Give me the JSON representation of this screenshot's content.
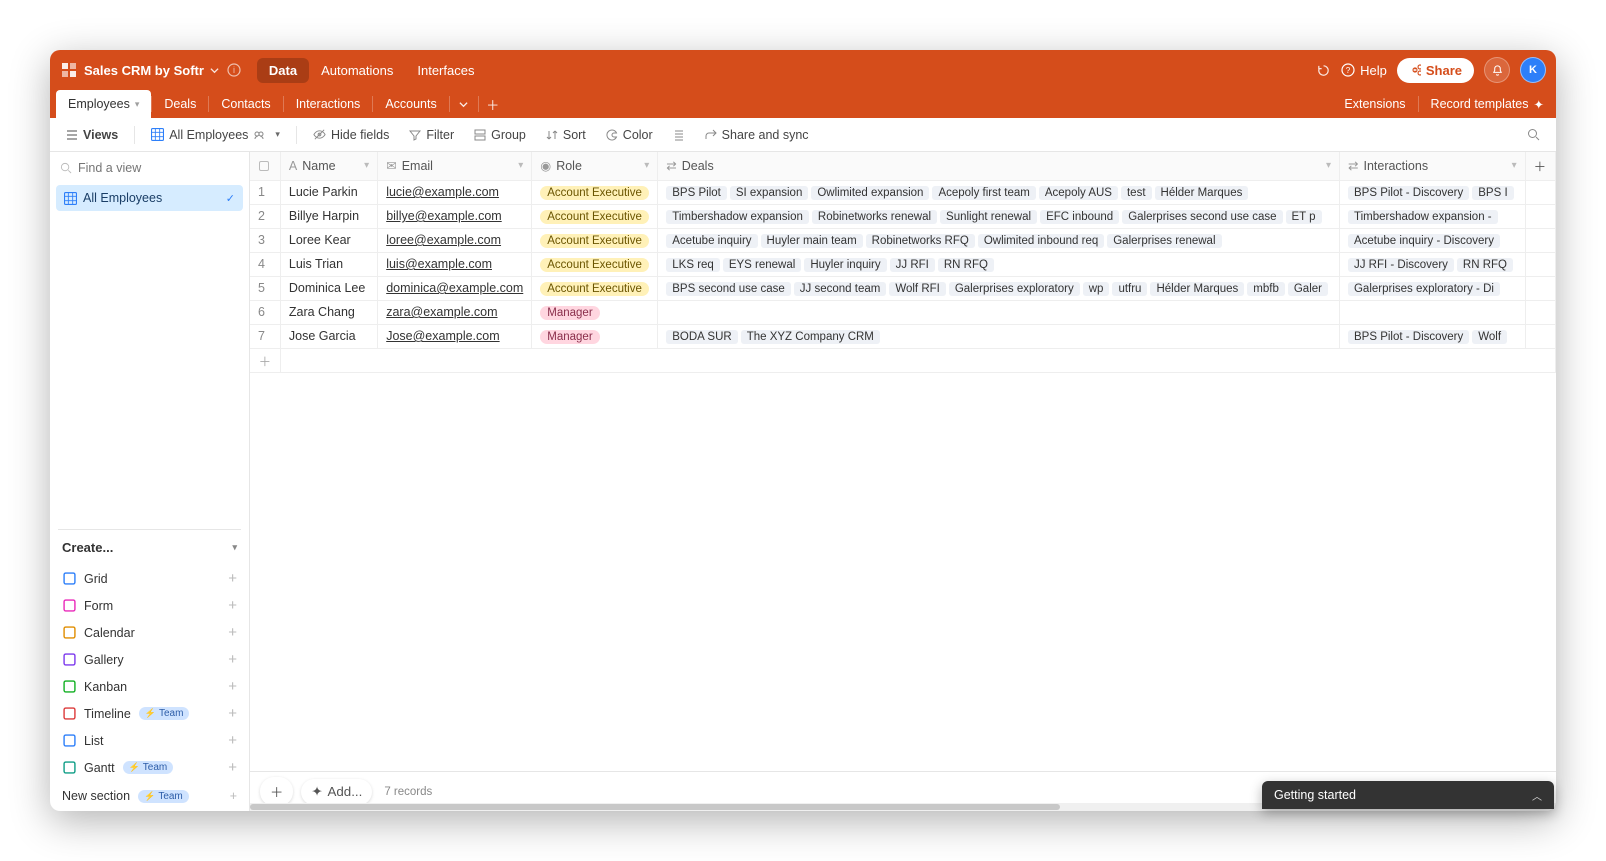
{
  "header": {
    "title": "Sales CRM by Softr",
    "nav": {
      "data": "Data",
      "automations": "Automations",
      "interfaces": "Interfaces"
    },
    "help": "Help",
    "share": "Share",
    "avatar_initial": "K"
  },
  "tabs": {
    "items": [
      {
        "label": "Employees",
        "active": true
      },
      {
        "label": "Deals"
      },
      {
        "label": "Contacts"
      },
      {
        "label": "Interactions"
      },
      {
        "label": "Accounts"
      }
    ],
    "extensions": "Extensions",
    "record_templates": "Record templates"
  },
  "toolbar": {
    "views": "Views",
    "view_name": "All Employees",
    "hide_fields": "Hide fields",
    "filter": "Filter",
    "group": "Group",
    "sort": "Sort",
    "color": "Color",
    "share_sync": "Share and sync"
  },
  "sidebar": {
    "find_placeholder": "Find a view",
    "active_view": "All Employees",
    "create_header": "Create...",
    "create_items": [
      {
        "label": "Grid",
        "color": "#2d7ff9"
      },
      {
        "label": "Form",
        "color": "#e929ba"
      },
      {
        "label": "Calendar",
        "color": "#e08d00"
      },
      {
        "label": "Gallery",
        "color": "#7c39ed"
      },
      {
        "label": "Kanban",
        "color": "#11af22"
      },
      {
        "label": "Timeline",
        "color": "#dc3a3a",
        "team": true
      },
      {
        "label": "List",
        "color": "#2d7ff9"
      },
      {
        "label": "Gantt",
        "color": "#0f9d86",
        "team": true
      }
    ],
    "new_section": "New section",
    "team_label": "Team"
  },
  "columns": {
    "name": "Name",
    "email": "Email",
    "role": "Role",
    "deals": "Deals",
    "interactions": "Interactions"
  },
  "rows": [
    {
      "n": "1",
      "name": "Lucie Parkin",
      "email": "lucie@example.com",
      "role": "Account Executive",
      "role_class": "ae",
      "deals": [
        "BPS Pilot",
        "SI expansion",
        "Owlimited expansion",
        "Acepoly first team",
        "Acepoly AUS",
        "test",
        "Hélder Marques"
      ],
      "interactions": [
        "BPS Pilot - Discovery",
        "BPS I"
      ]
    },
    {
      "n": "2",
      "name": "Billye Harpin",
      "email": "billye@example.com",
      "role": "Account Executive",
      "role_class": "ae",
      "deals": [
        "Timbershadow expansion",
        "Robinetworks renewal",
        "Sunlight renewal",
        "EFC inbound",
        "Galerprises second use case",
        "ET p"
      ],
      "interactions": [
        "Timbershadow expansion -"
      ]
    },
    {
      "n": "3",
      "name": "Loree Kear",
      "email": "loree@example.com",
      "role": "Account Executive",
      "role_class": "ae",
      "deals": [
        "Acetube inquiry",
        "Huyler main team",
        "Robinetworks RFQ",
        "Owlimited inbound req",
        "Galerprises renewal"
      ],
      "interactions": [
        "Acetube inquiry - Discovery"
      ]
    },
    {
      "n": "4",
      "name": "Luis Trian",
      "email": "luis@example.com",
      "role": "Account Executive",
      "role_class": "ae",
      "deals": [
        "LKS req",
        "EYS renewal",
        "Huyler inquiry",
        "JJ RFI",
        "RN RFQ"
      ],
      "interactions": [
        "JJ RFI - Discovery",
        "RN RFQ"
      ]
    },
    {
      "n": "5",
      "name": "Dominica Lee",
      "email": "dominica@example.com",
      "role": "Account Executive",
      "role_class": "ae",
      "deals": [
        "BPS second use case",
        "JJ second team",
        "Wolf RFI",
        "Galerprises exploratory",
        "wp",
        "utfru",
        "Hélder Marques",
        "mbfb",
        "Galer"
      ],
      "interactions": [
        "Galerprises exploratory - Di"
      ]
    },
    {
      "n": "6",
      "name": "Zara Chang",
      "email": "zara@example.com",
      "role": "Manager",
      "role_class": "mgr",
      "deals": [],
      "interactions": []
    },
    {
      "n": "7",
      "name": "Jose Garcia",
      "email": "Jose@example.com",
      "role": "Manager",
      "role_class": "mgr",
      "deals": [
        "BODA SUR",
        "The XYZ Company CRM"
      ],
      "interactions": [
        "BPS Pilot - Discovery",
        "Wolf"
      ]
    }
  ],
  "footer": {
    "add": "Add...",
    "records": "7 records"
  },
  "getting_started": "Getting started"
}
